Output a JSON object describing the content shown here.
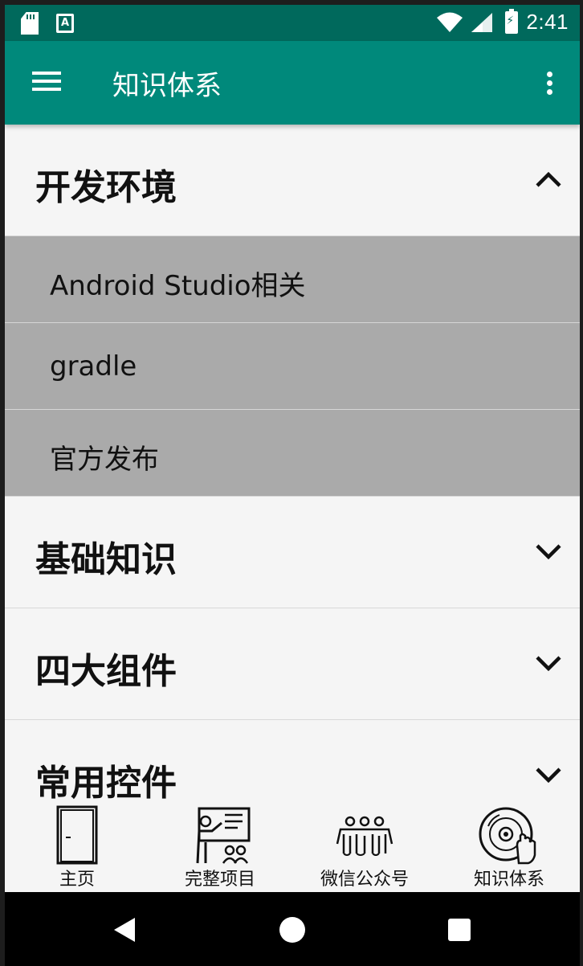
{
  "status_bar": {
    "time": "2:41",
    "left_icons": [
      "sd-card-icon",
      "a-notification-icon"
    ],
    "right_icons": [
      "wifi-icon",
      "signal-icon",
      "battery-charging-icon"
    ],
    "a_icon_text": "A"
  },
  "app_bar": {
    "title": "知识体系",
    "left_icon": "menu-icon",
    "right_icon": "more-vert-icon",
    "background": "#00897b"
  },
  "groups": [
    {
      "title": "开发环境",
      "expanded": true,
      "children": [
        {
          "label": "Android Studio相关"
        },
        {
          "label": "gradle"
        },
        {
          "label": "官方发布"
        }
      ]
    },
    {
      "title": "基础知识",
      "expanded": false,
      "children": []
    },
    {
      "title": "四大组件",
      "expanded": false,
      "children": []
    },
    {
      "title": "常用控件",
      "expanded": false,
      "children": []
    }
  ],
  "bottom_nav": {
    "items": [
      {
        "label": "主页",
        "icon": "door-icon"
      },
      {
        "label": "完整项目",
        "icon": "teacher-board-icon"
      },
      {
        "label": "微信公众号",
        "icon": "people-group-icon"
      },
      {
        "label": "知识体系",
        "icon": "disc-hand-icon"
      }
    ]
  },
  "system_nav": {
    "buttons": [
      "back-icon",
      "home-icon",
      "recents-icon"
    ]
  },
  "colors": {
    "status_bar": "#00695c",
    "app_bar": "#00897b",
    "child_background": "#aaaaaa",
    "page_background": "#f5f5f5"
  }
}
